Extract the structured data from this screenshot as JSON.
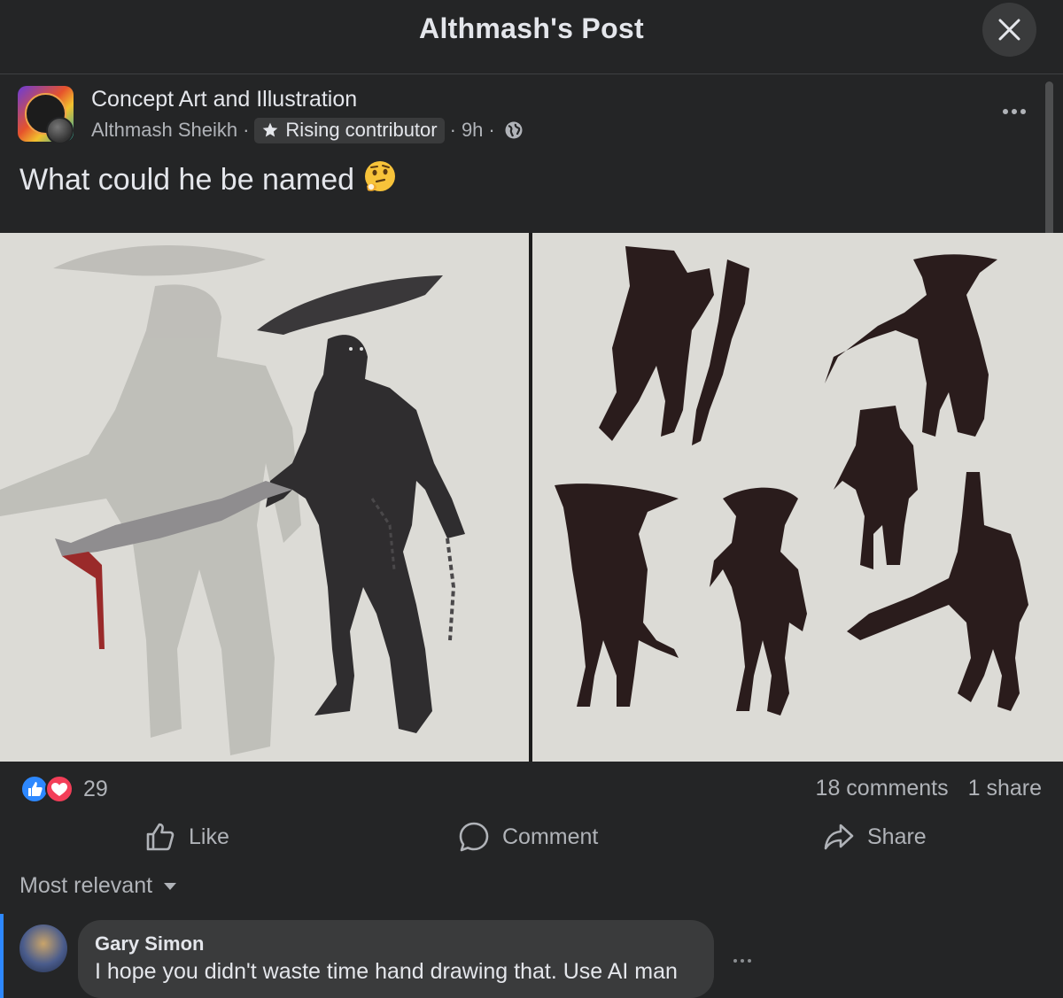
{
  "header": {
    "title": "Althmash's Post",
    "close_icon": "close-icon"
  },
  "post": {
    "group_name": "Concept Art and Illustration",
    "author": "Althmash Sheikh",
    "separator": "·",
    "badge": "Rising contributor",
    "badge_icon": "star-icon",
    "time": "9h",
    "privacy_icon": "globe-icon",
    "text": "What could he be named",
    "emoji_icon": "thinking-face-icon",
    "images": [
      {
        "name": "horned-warrior-concept-art"
      },
      {
        "name": "silhouette-thumbnails"
      }
    ]
  },
  "engagement": {
    "reaction_icons": [
      "like-reaction-icon",
      "love-reaction-icon"
    ],
    "reaction_count": "29",
    "comments": "18 comments",
    "shares": "1 share"
  },
  "actions": {
    "like": "Like",
    "comment": "Comment",
    "share": "Share"
  },
  "comments": {
    "sort_label": "Most relevant",
    "items": [
      {
        "name": "Gary Simon",
        "text": "I hope you didn't waste time hand drawing that. Use AI man"
      }
    ]
  },
  "colors": {
    "background": "#242526",
    "surface": "#3a3b3c",
    "text_primary": "#e4e6eb",
    "text_secondary": "#b0b3b8",
    "accent": "#2d88ff",
    "love": "#f33e58"
  }
}
